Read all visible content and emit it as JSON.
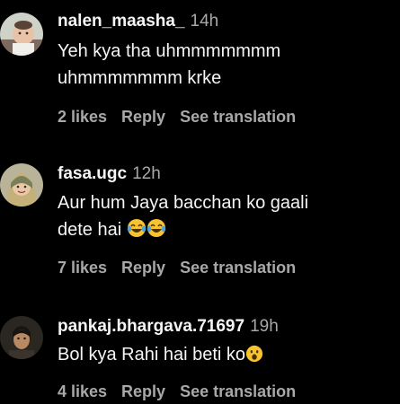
{
  "comments": [
    {
      "username": "nalen_maasha_",
      "time": "14h",
      "text_line1": "Yeh kya tha uhmmmmmmm",
      "text_line2": "uhmmmmmmm krke",
      "likes": "2 likes",
      "reply": "Reply",
      "translate": "See translation"
    },
    {
      "username": "fasa.ugc",
      "time": "12h",
      "text_line1": "Aur hum Jaya bacchan ko gaali",
      "text_line2": "dete hai",
      "emoji_names": [
        "face-with-tears-of-joy-emoji",
        "face-with-tears-of-joy-emoji"
      ],
      "likes": "7 likes",
      "reply": "Reply",
      "translate": "See translation"
    },
    {
      "username": "pankaj.bhargava.71697",
      "time": "19h",
      "text_line1": "Bol kya Rahi hai beti ko",
      "emoji_names": [
        "face-with-open-mouth-emoji"
      ],
      "likes": "4 likes",
      "reply": "Reply",
      "translate": "See translation"
    }
  ],
  "colors": {
    "background": "#000000",
    "primary_text": "#f5f5f5",
    "secondary_text": "#a8a8a8"
  }
}
